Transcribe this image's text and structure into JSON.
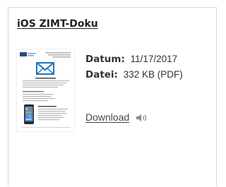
{
  "card": {
    "title": "iOS ZIMT-Doku"
  },
  "file": {
    "date_label": "Datum:",
    "date_value": "11/17/2017",
    "file_label": "Datei:",
    "file_value": "332 KB (PDF)",
    "download_label": "Download"
  },
  "icons": {
    "thumbnail": "document-thumbnail",
    "envelope": "envelope-icon",
    "speaker": "speaker-icon"
  },
  "colors": {
    "title": "#222222",
    "text": "#333333",
    "border": "#d6d6d6",
    "envelope": "#1f76b8",
    "speaker": "#8a8a8a"
  }
}
